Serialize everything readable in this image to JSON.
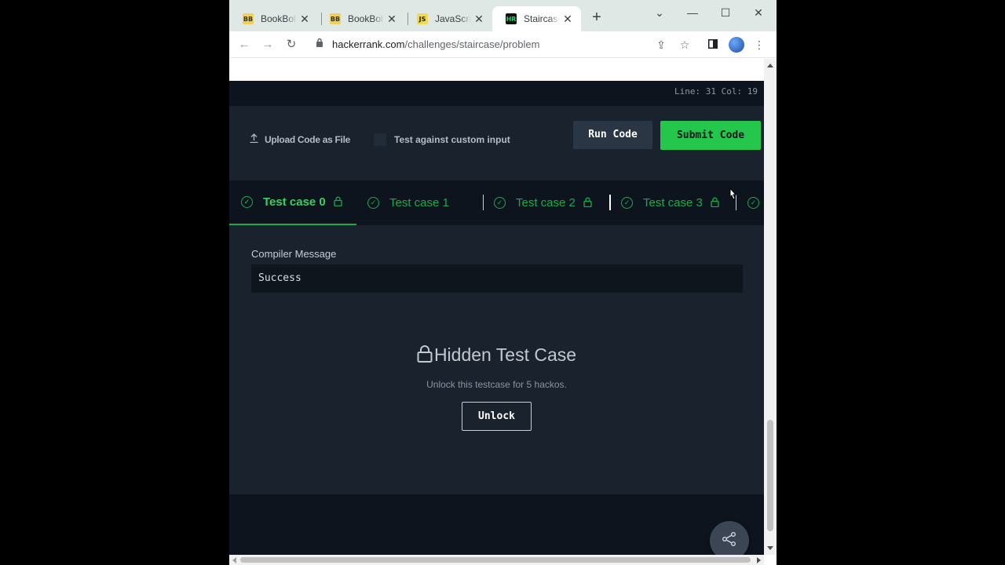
{
  "browser": {
    "tabs": [
      {
        "title": "BookBolt",
        "favicon": "BB",
        "active": false
      },
      {
        "title": "BookBolt",
        "favicon": "BB",
        "active": false
      },
      {
        "title": "JavaScript",
        "favicon": "JS",
        "active": false
      },
      {
        "title": "Staircase",
        "favicon": "HR",
        "active": true
      }
    ],
    "url_domain": "hackerrank.com",
    "url_path": "/challenges/staircase/problem"
  },
  "editor": {
    "line_col": "Line: 31 Col: 19"
  },
  "actions": {
    "upload_label": "Upload Code as File",
    "custom_input_label": "Test against custom input",
    "run_label": "Run Code",
    "submit_label": "Submit Code"
  },
  "test_cases": [
    {
      "label": "Test case 0",
      "locked": true,
      "active": true
    },
    {
      "label": "Test case 1",
      "locked": false,
      "active": false
    },
    {
      "label": "Test case 2",
      "locked": true,
      "active": false
    },
    {
      "label": "Test case 3",
      "locked": true,
      "active": false
    }
  ],
  "result": {
    "compiler_label": "Compiler Message",
    "compiler_value": "Success",
    "hidden_title": "Hidden Test Case",
    "hidden_sub": "Unlock this testcase for 5 hackos.",
    "unlock_label": "Unlock"
  },
  "colors": {
    "accent_green": "#1ba94c",
    "submit_green": "#24c74c",
    "bg_dark": "#0e141e",
    "panel_dark": "#1a222e"
  }
}
